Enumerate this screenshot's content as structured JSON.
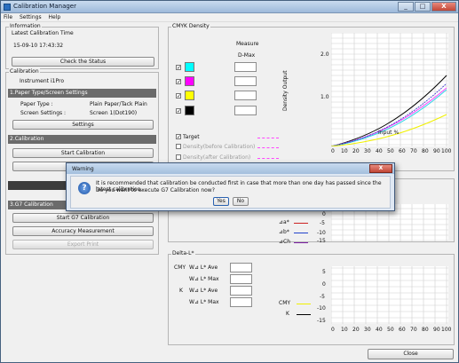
{
  "window": {
    "title": "Calibration Manager",
    "minimize": "_",
    "maximize": "□",
    "close": "X"
  },
  "menu": [
    "File",
    "Settings",
    "Help"
  ],
  "information": {
    "group_label": "Information",
    "latest_label": "Latest Calibration Time",
    "latest_value": "15-09-10 17:43:32",
    "check_button": "Check the Status"
  },
  "calibration": {
    "group_label": "Calibration",
    "instrument_label": "Instrument :",
    "instrument_value": "i1Pro",
    "paper_section": "1.Paper Type/Screen Settings",
    "paper_type_label": "Paper Type :",
    "paper_type_value": "Plain Paper/Tack Plain",
    "screen_settings_label": "Screen Settings :",
    "screen_settings_value": "Screen 1(Dot190)",
    "settings_button": "Settings",
    "calibration_section": "2.Calibration",
    "start_calibration_button": "Start Calibration",
    "accuracy_partial_button": "Accu",
    "hidden_partial_button": "H",
    "g7_section": "3.G7 Calibration",
    "start_g7_button": "Start G7 Calibration",
    "accuracy_measurement_button": "Accuracy Measurement",
    "export_print_button": "Export Print"
  },
  "cmyk_density": {
    "group_label": "CMYK Density",
    "measure_label": "Measure",
    "dmax_label": "D-Max",
    "rows": [
      {
        "checked": true,
        "color": "#00ffff"
      },
      {
        "checked": true,
        "color": "#ff00ff"
      },
      {
        "checked": true,
        "color": "#ffff00"
      },
      {
        "checked": true,
        "color": "#000000"
      }
    ],
    "legend": [
      {
        "label": "Target",
        "checked": true,
        "color": "#ff44ff"
      },
      {
        "label": "Density(before Calibration)",
        "checked": false,
        "color": "#ff44ff"
      },
      {
        "label": "Density(after Calibration)",
        "checked": false,
        "color": "#ff44ff"
      }
    ],
    "chart": {
      "ylabel": "Density Output",
      "xlabel": "Input %",
      "y_ticks": [
        "2.0",
        "1.0",
        "0.0"
      ],
      "x_ticks": [
        "0",
        "10",
        "20",
        "30",
        "40",
        "50",
        "60",
        "70",
        "80",
        "90",
        "100"
      ]
    }
  },
  "gray_balance": {
    "legend": [
      {
        "label": "⊿a*",
        "color": "#cc2222"
      },
      {
        "label": "⊿b*",
        "color": "#2244cc"
      },
      {
        "label": "⊿Ch",
        "color": "#7a1fa2"
      }
    ],
    "y_ticks": [
      "0",
      "-5",
      "-10",
      "-15"
    ]
  },
  "delta_l": {
    "group_label": "Delta-L*",
    "cmy_label": "CMY",
    "k_label": "K",
    "ave_label": "⊿ L* Ave",
    "max_label": "⊿ L* Max",
    "w_prefix": "W",
    "legend_cmy": "CMY",
    "legend_k": "K",
    "y_ticks": [
      "5",
      "0",
      "-5",
      "-10",
      "-15"
    ],
    "x_ticks": [
      "0",
      "10",
      "20",
      "30",
      "40",
      "50",
      "60",
      "70",
      "80",
      "90",
      "100"
    ]
  },
  "close_button": "Close",
  "dialog": {
    "title": "Warning",
    "message_line1": "It is recommended that calibration be conducted first in case that more than one day has passed since the latest calibration.",
    "message_line2": "Do you want to execute G7 Calibration now?",
    "yes_button": "Yes",
    "no_button": "No",
    "close": "X"
  },
  "colors": {
    "accent": "#3a75c4",
    "section": "#6b6b6b",
    "warning_icon": "#2a5fb0"
  }
}
